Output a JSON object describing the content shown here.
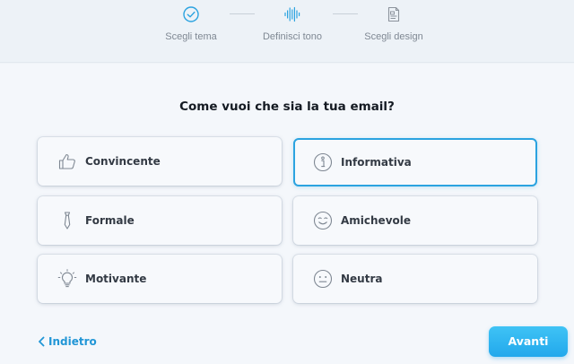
{
  "stepper": {
    "steps": [
      {
        "label": "Scegli tema",
        "icon": "check-circle-icon",
        "state": "completed"
      },
      {
        "label": "Definisci tono",
        "icon": "sound-wave-icon",
        "state": "current"
      },
      {
        "label": "Scegli design",
        "icon": "design-document-icon",
        "state": "upcoming"
      }
    ]
  },
  "question": "Come vuoi che sia la tua email?",
  "options": [
    {
      "label": "Convincente",
      "icon": "thumbs-up-icon",
      "selected": false
    },
    {
      "label": "Informativa",
      "icon": "info-icon",
      "selected": true
    },
    {
      "label": "Formale",
      "icon": "tie-icon",
      "selected": false
    },
    {
      "label": "Amichevole",
      "icon": "winking-face-icon",
      "selected": false
    },
    {
      "label": "Motivante",
      "icon": "lightbulb-icon",
      "selected": false
    },
    {
      "label": "Neutra",
      "icon": "neutral-face-icon",
      "selected": false
    }
  ],
  "footer": {
    "back_label": "Indietro",
    "next_label": "Avanti"
  },
  "colors": {
    "accent": "#2ba3e0",
    "button_gradient_top": "#3fc3f5",
    "button_gradient_bottom": "#22a8ec",
    "back_link": "#2196d6"
  }
}
